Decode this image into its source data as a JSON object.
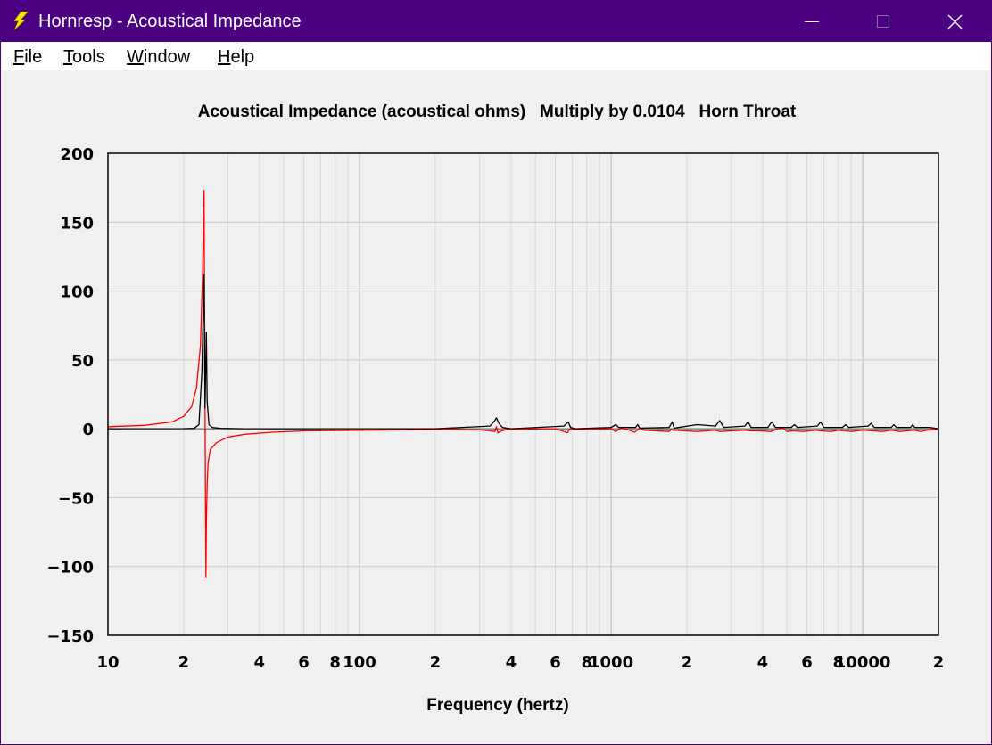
{
  "window": {
    "title": "Hornresp - Acoustical Impedance",
    "icon": "lightning-bolt-icon",
    "title_bar_color": "#4b0082"
  },
  "menu": [
    "File",
    "Tools",
    "Window",
    "Help"
  ],
  "chart_data": {
    "type": "line",
    "title": "Acoustical Impedance (acoustical ohms)   Multiply by 0.0104   Horn Throat",
    "xlabel": "Frequency (hertz)",
    "ylabel": "",
    "x_scale": "log",
    "xlim": [
      10,
      20000
    ],
    "ylim": [
      -150,
      200
    ],
    "grid": true,
    "y_ticks": [
      200,
      150,
      100,
      50,
      0,
      -50,
      -100,
      -150
    ],
    "y_tick_labels": [
      "200",
      "150",
      "100",
      "50",
      "0",
      "−50",
      "−100",
      "−150"
    ],
    "x_ticks": [
      10,
      20,
      40,
      60,
      80,
      100,
      200,
      400,
      600,
      800,
      1000,
      2000,
      4000,
      6000,
      8000,
      10000,
      20000
    ],
    "x_tick_labels": [
      "10",
      "2",
      "4",
      "6",
      "8",
      "100",
      "2",
      "4",
      "6",
      "8",
      "1000",
      "2",
      "4",
      "6",
      "8",
      "10000",
      "2"
    ],
    "series": [
      {
        "color": "#ff0000",
        "x": [
          10,
          14,
          18,
          20,
          21.5,
          22.5,
          23.3,
          23.8,
          24.1,
          24.25,
          24.4,
          24.5,
          24.6,
          24.8,
          25,
          25.5,
          27,
          30,
          35,
          45,
          60,
          200,
          300,
          330,
          345,
          350,
          355,
          362,
          375,
          390,
          450,
          600,
          650,
          670,
          680,
          690,
          720,
          1000,
          1040,
          1055,
          1080,
          1100,
          1180,
          1240,
          1270,
          1300,
          1350,
          1700,
          1730,
          1760,
          2200,
          2600,
          2700,
          3400,
          3600,
          3900,
          4300,
          4800,
          5000,
          5300,
          5800,
          6500,
          6800,
          7500,
          8000,
          8500,
          9000,
          10000,
          11000,
          12000,
          13000,
          14000,
          15000,
          16000,
          17000,
          18000,
          20000
        ],
        "y": [
          1.5,
          2.5,
          5,
          9,
          16,
          30,
          60,
          115,
          173,
          60,
          -50,
          -108,
          -70,
          -40,
          -25,
          -15,
          -10,
          -6,
          -4,
          -2.5,
          -1.5,
          -0.5,
          -0.8,
          -1.5,
          -2,
          1.5,
          -3,
          -2,
          -1,
          -0.5,
          -0.3,
          0,
          -2,
          -3,
          -1,
          0,
          -0.5,
          0,
          -2,
          -1.5,
          0,
          0.5,
          -1,
          -2.5,
          -1,
          0.5,
          -1,
          -2,
          -0.5,
          -1,
          -2,
          -1,
          -2,
          -1,
          -1.5,
          -1.5,
          -2,
          1,
          -2,
          -1.5,
          -2,
          -1,
          -1.5,
          -2,
          -1,
          -1.5,
          -2,
          -1,
          -1.5,
          -2,
          -1,
          -2,
          -1.5,
          -1,
          -2,
          -1,
          -0.5
        ]
      },
      {
        "color": "#000000",
        "x": [
          10,
          20,
          22,
          23,
          23.6,
          24.1,
          24.3,
          24.6,
          24.8,
          25.2,
          26,
          28,
          35,
          60,
          200,
          330,
          345,
          350,
          358,
          370,
          400,
          650,
          675,
          690,
          720,
          1000,
          1045,
          1070,
          1250,
          1275,
          1300,
          1700,
          1750,
          1780,
          2200,
          2600,
          2700,
          2800,
          3400,
          3500,
          3600,
          4200,
          4350,
          4500,
          5200,
          5350,
          5500,
          6600,
          6800,
          7000,
          8300,
          8550,
          8800,
          10500,
          10800,
          11100,
          13000,
          13300,
          13600,
          15500,
          15800,
          16100,
          18500,
          20000
        ],
        "y": [
          0,
          0.1,
          0.3,
          3,
          40,
          112,
          15,
          70,
          20,
          3,
          1,
          0.3,
          0,
          0,
          0,
          2,
          6,
          8,
          4,
          1,
          0,
          2,
          5,
          1,
          0,
          1,
          3,
          1,
          1,
          3,
          0.5,
          1,
          5,
          0.5,
          3,
          2,
          6,
          1,
          2,
          5,
          1,
          1,
          5,
          1,
          1,
          3,
          1,
          2,
          5,
          1,
          1,
          3,
          1,
          2,
          4,
          1,
          1,
          3,
          1,
          1,
          3,
          1,
          1,
          0
        ]
      }
    ]
  }
}
